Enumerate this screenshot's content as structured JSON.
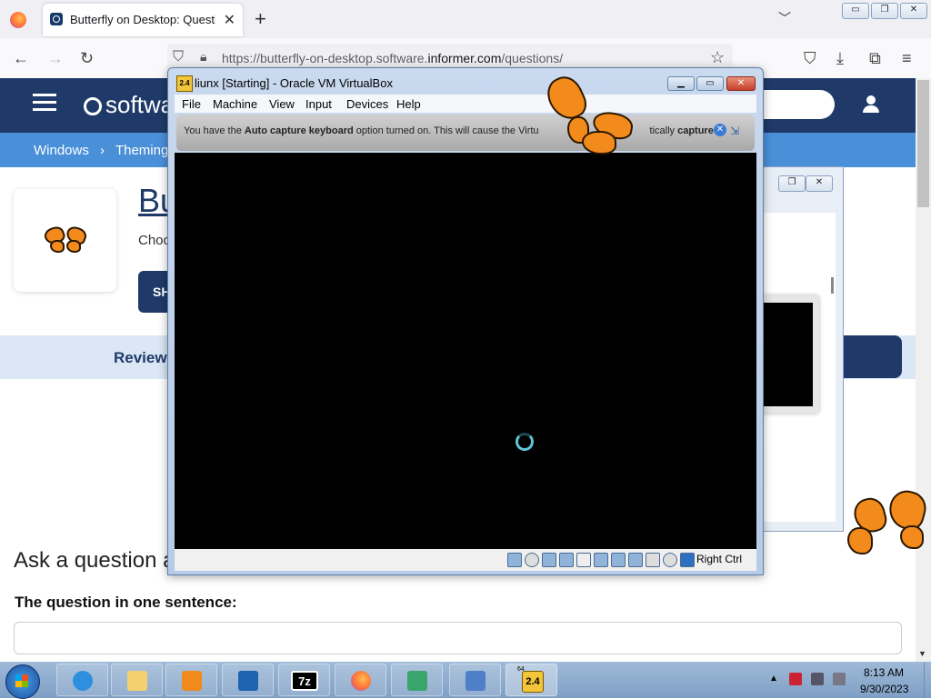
{
  "browser": {
    "tab_title": "Butterfly on Desktop: Question",
    "tab_close": "✕",
    "new_tab": "+",
    "url_prefix": "https://butterfly-on-desktop.software.",
    "url_domain": "informer.com",
    "url_suffix": "/questions/",
    "window_controls": [
      "▭",
      "❐",
      "✕"
    ]
  },
  "site": {
    "logo": "softwa",
    "breadcrumb": [
      "Windows",
      "Theming"
    ],
    "breadcrumb_sep": "›",
    "app_title": "Bu",
    "app_subtitle": "Choo",
    "show_button": "SH",
    "review_tab": "Review",
    "ask_heading": "Ask a question a",
    "question_label": "The question in one sentence:"
  },
  "virtualbox": {
    "title": "liunx [Starting] - Oracle VM VirtualBox",
    "icon_label": "2.4",
    "menu": [
      "File",
      "Machine",
      "View",
      "Input",
      "Devices",
      "Help"
    ],
    "notice_part1": "You have the ",
    "notice_bold1": "Auto capture keyboard",
    "notice_part2": " option turned on. This will cause the Virtu",
    "notice_part3": "tically ",
    "notice_bold2": "capture",
    "host_key": "Right Ctrl"
  },
  "taskbar": {
    "items": [
      "internet-explorer",
      "file-explorer",
      "media-player",
      "virtualbox",
      "7zip",
      "firefox",
      "network-app",
      "remote-desktop",
      "vbox-2.4"
    ],
    "sevenzip_label": "7z",
    "vbox_badge": "2.4",
    "vbox_badge_64": "64",
    "time": "8:13 AM",
    "date": "9/30/2023"
  },
  "colors": {
    "site_header": "#1f3a68",
    "breadcrumb_bar": "#4a90d9",
    "butterfly_orange": "#f28a1c"
  }
}
